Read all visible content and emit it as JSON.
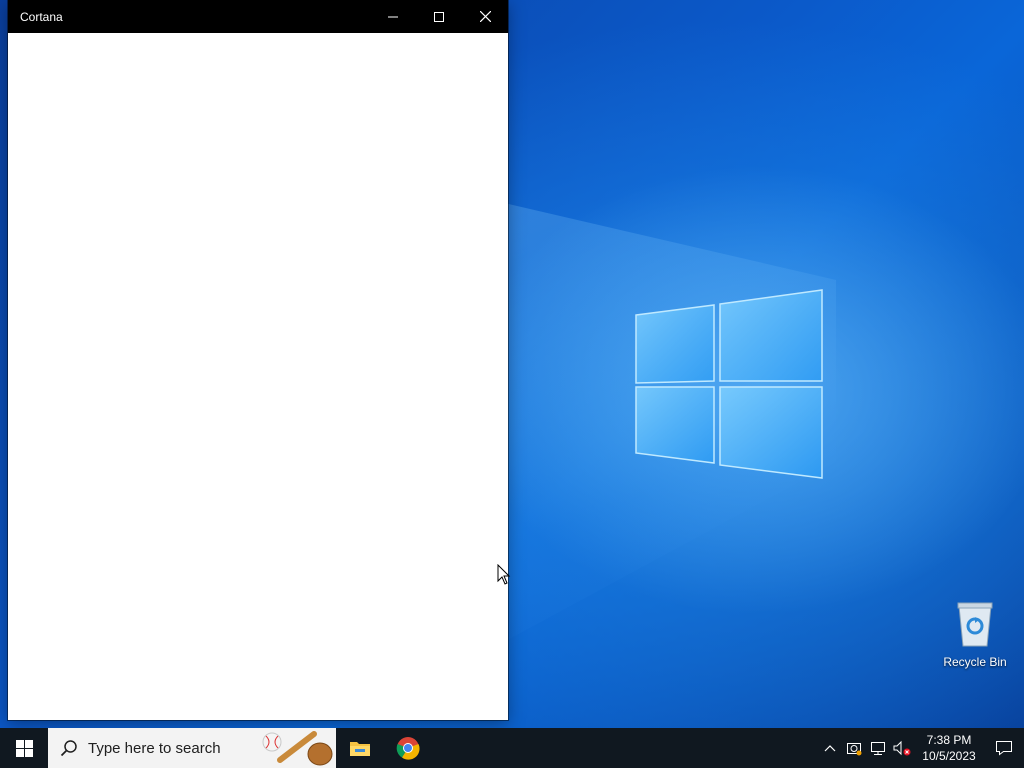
{
  "window": {
    "title": "Cortana",
    "controls": {
      "minimize": "minimize-icon",
      "maximize": "maximize-icon",
      "close": "close-icon"
    }
  },
  "desktop": {
    "icons": [
      {
        "label": "Recycle Bin",
        "icon": "recycle-bin-icon"
      }
    ]
  },
  "taskbar": {
    "start_icon": "windows-start-icon",
    "search": {
      "placeholder": "Type here to search",
      "icon": "search-icon"
    },
    "apps": [
      {
        "name": "File Explorer",
        "icon": "folder-icon"
      },
      {
        "name": "Google Chrome",
        "icon": "chrome-icon"
      }
    ],
    "tray": {
      "icons": [
        "chevron-up-icon",
        "update-icon",
        "network-icon",
        "volume-muted-icon"
      ],
      "time": "7:38 PM",
      "date": "10/5/2023",
      "notification_icon": "notification-icon"
    }
  },
  "colors": {
    "taskbar": "#101820",
    "titlebar": "#000000",
    "wallpaper_accent": "#0b59c9"
  }
}
